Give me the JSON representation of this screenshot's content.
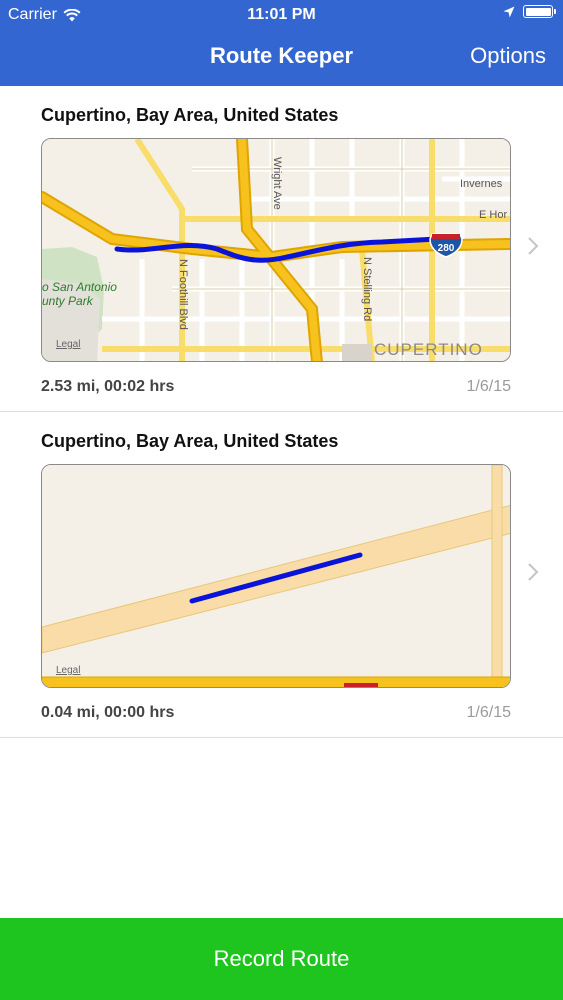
{
  "status_bar": {
    "carrier": "Carrier",
    "time": "11:01 PM"
  },
  "nav": {
    "title": "Route Keeper",
    "options_label": "Options"
  },
  "routes": [
    {
      "location": "Cupertino, Bay Area, United States",
      "stats": "2.53 mi, 00:02 hrs",
      "date": "1/6/15",
      "map_labels": {
        "street_1": "Wright Ave",
        "street_2": "N Foothill Blvd",
        "street_3": "N Stelling Rd",
        "street_4": "Invernes",
        "street_5": "E Hor",
        "park": "o San Antonio",
        "park2": "unty Park",
        "city": "CUPERTINO",
        "shield": "280",
        "legal": "Legal"
      }
    },
    {
      "location": "Cupertino, Bay Area, United States",
      "stats": "0.04 mi, 00:00 hrs",
      "date": "1/6/15",
      "map_labels": {
        "legal": "Legal"
      }
    }
  ],
  "record_button": "Record Route",
  "colors": {
    "nav_bg": "#3466d1",
    "record_bg": "#1ec51e",
    "route_line": "#0a14d8",
    "highway": "#f7c21e"
  }
}
